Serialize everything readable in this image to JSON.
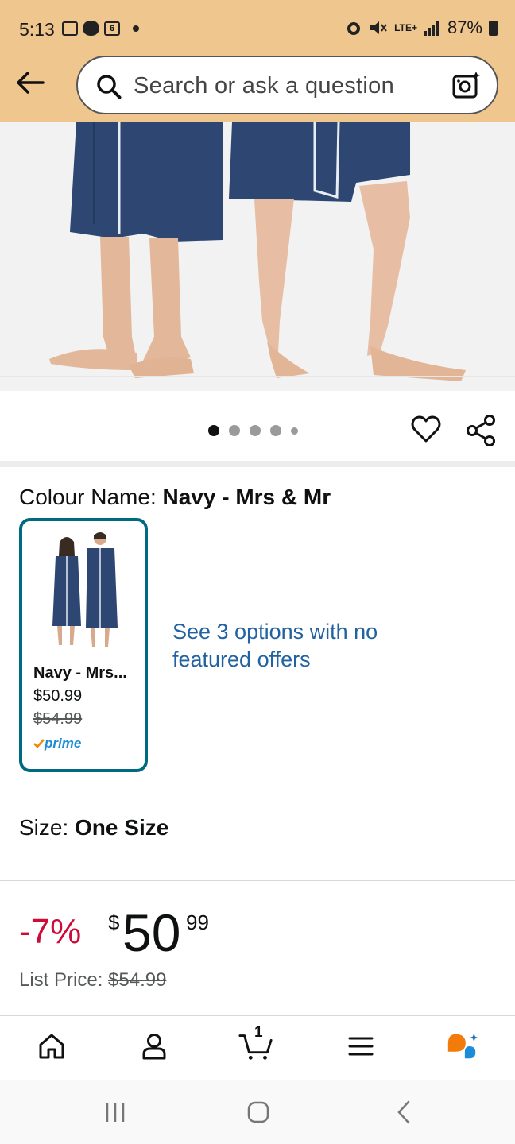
{
  "status_bar": {
    "time": "5:13",
    "notification_badge": "6",
    "network": "LTE+",
    "battery": "87%"
  },
  "search": {
    "placeholder": "Search or ask a question"
  },
  "carousel": {
    "total_images": 5,
    "active_index": 0
  },
  "variation": {
    "label": "Colour Name:",
    "selected_value": "Navy - Mrs & Mr",
    "swatch": {
      "name": "Navy - Mrs...",
      "price": "$50.99",
      "old_price": "$54.99",
      "badge": "prime"
    },
    "more_options": "See 3 options with no featured offers"
  },
  "size": {
    "label": "Size:",
    "value": "One Size"
  },
  "price": {
    "discount": "-7%",
    "currency": "$",
    "whole": "50",
    "fraction": "99",
    "list_price_label": "List Price:",
    "list_price": "$54.99"
  },
  "bottom_nav": {
    "cart_count": "1",
    "items": [
      "home-icon",
      "account-icon",
      "cart-icon",
      "menu-icon",
      "rufus-icon"
    ]
  },
  "colors": {
    "header_bg": "#f0c68f",
    "swatch_border": "#006a80",
    "link": "#2162a1",
    "discount": "#cc0c39",
    "robe": "#2d4672"
  }
}
